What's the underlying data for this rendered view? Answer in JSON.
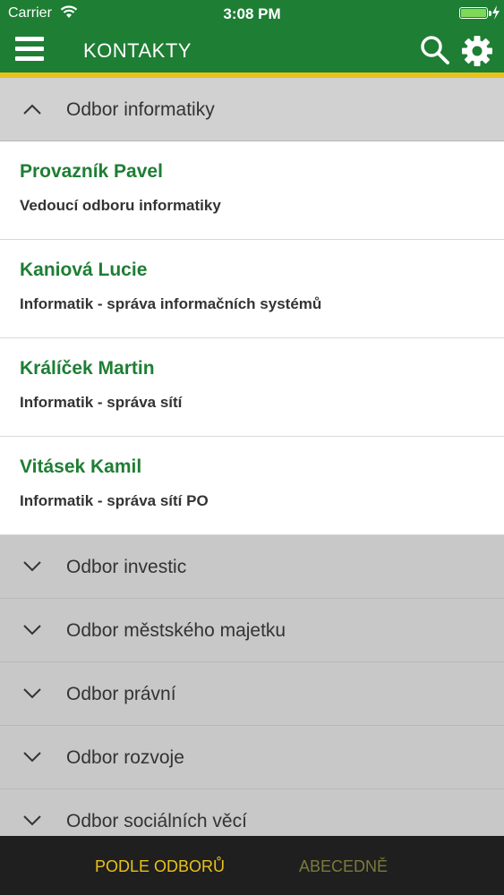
{
  "status_bar": {
    "carrier": "Carrier",
    "time": "3:08 PM"
  },
  "nav": {
    "title": "KONTAKTY"
  },
  "sections": [
    {
      "label": "Odbor informatiky",
      "expanded": true,
      "contacts": [
        {
          "name": "Provazník Pavel",
          "role": "Vedoucí odboru informatiky"
        },
        {
          "name": "Kaniová Lucie",
          "role": "Informatik - správa informačních systémů"
        },
        {
          "name": "Králíček Martin",
          "role": "Informatik - správa sítí"
        },
        {
          "name": "Vitásek Kamil",
          "role": "Informatik - správa sítí PO"
        }
      ]
    },
    {
      "label": "Odbor investic",
      "expanded": false
    },
    {
      "label": "Odbor městského majetku",
      "expanded": false
    },
    {
      "label": "Odbor právní",
      "expanded": false
    },
    {
      "label": "Odbor rozvoje",
      "expanded": false
    },
    {
      "label": "Odbor sociálních věcí",
      "expanded": false
    }
  ],
  "tabs": {
    "by_department": "PODLE ODBORŮ",
    "alphabetical": "ABECEDNĚ"
  },
  "colors": {
    "primary": "#1e7e34",
    "accent": "#e8c21a",
    "tabbar": "#1f1f1f"
  }
}
